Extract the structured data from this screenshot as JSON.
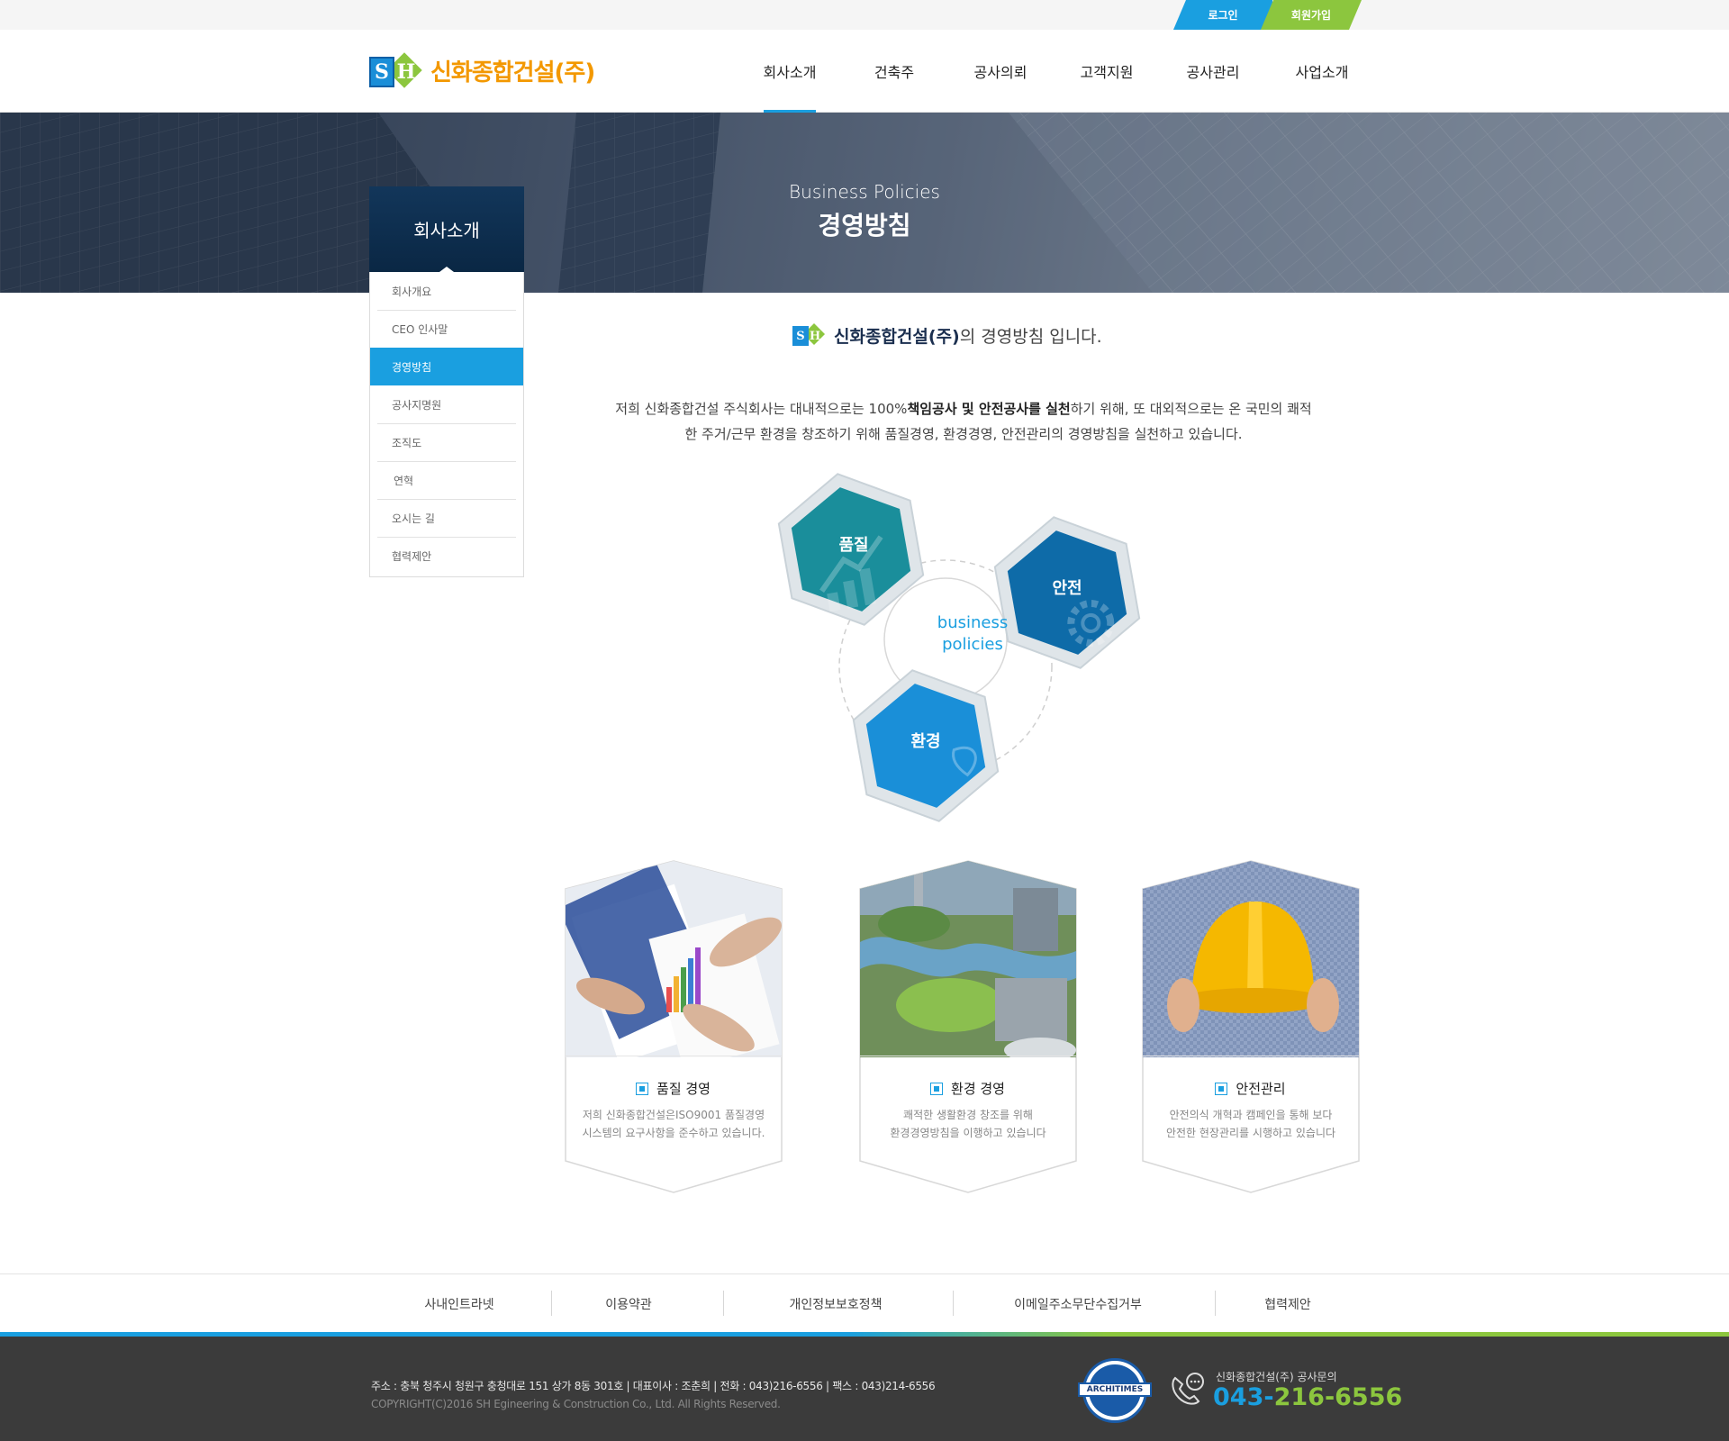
{
  "topbar": {
    "login": "로그인",
    "join": "회원가입"
  },
  "header": {
    "logo_text": "신화종합건설(주)",
    "logo_s": "S",
    "logo_h": "H",
    "nav": [
      "회사소개",
      "건축주",
      "공사의뢰",
      "고객지원",
      "공사관리",
      "사업소개"
    ],
    "active_nav": "회사소개"
  },
  "hero": {
    "title_en": "Business Policies",
    "title_ko": "경영방침"
  },
  "lnb": {
    "title": "회사소개",
    "items": [
      "회사개요",
      "CEO 인사말",
      "경영방침",
      "공사지명원",
      "조직도",
      "연혁",
      "오시는 길",
      "협력제안"
    ],
    "active": "경영방침"
  },
  "intro": {
    "company": "신화종합건설(주)",
    "rest": "의 경영방침 입니다."
  },
  "description": {
    "part1": "저희 신화종합건설 주식회사는 대내적으로는 100%",
    "bold1": "책임공사 및 안전공사를 실천",
    "part2": "하기 위해, 또 대외적으로는 온 국민의 쾌적",
    "line2": "한 주거/근무 환경을 창조하기 위해 품질경영, 환경경영, 안전관리의 경영방침을 실천하고 있습니다."
  },
  "diagram": {
    "center_line1": "business",
    "center_line2": "policies",
    "quality": "품질",
    "safety": "안전",
    "environment": "환경"
  },
  "cards": [
    {
      "title": "품질 경영",
      "desc1": "저희 신화종합건설은ISO9001 품질경영",
      "desc2": "시스템의 요구사항을 준수하고 있습니다."
    },
    {
      "title": "환경 경영",
      "desc1": "쾌적한 생활환경 창조를 위해",
      "desc2": "환경경영방침을 이행하고 있습니다"
    },
    {
      "title": "안전관리",
      "desc1": "안전의식 개혁과 캠페인을 통해 보다",
      "desc2": "안전한 현장관리를 시행하고 있습니다"
    }
  ],
  "footer_links": [
    "사내인트라넷",
    "이용약관",
    "개인정보보호정책",
    "이메일주소무단수집거부",
    "협력제안"
  ],
  "footer": {
    "address": "주소 : 충북 청주시 청원구 충청대로 151 상가 8동 301호  |  대표이사 : 조춘희  |  전화 : 043)216-6556  |  팩스 : 043)214-6556",
    "copyright": "COPYRIGHT(C)2016  SH Egineering & Construction  Co., Ltd. All Rights Reserved.",
    "badge_text": "ARCHITIMES",
    "cs_label": "신화종합건설(주) 공사문의",
    "phone_prefix": "043-",
    "phone_suffix": "216-6556"
  },
  "colors": {
    "primary_blue": "#1a9fe0",
    "accent_green": "#8cc63e",
    "logo_orange": "#f39800",
    "navy": "#12365a"
  }
}
